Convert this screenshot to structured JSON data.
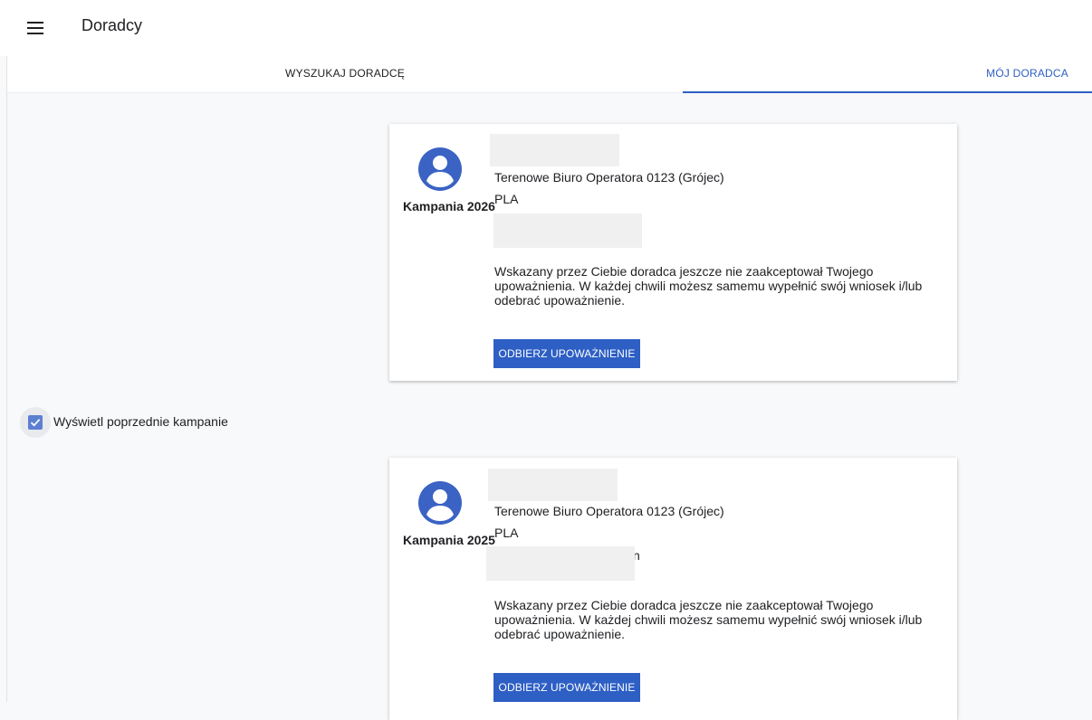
{
  "header": {
    "menu_icon": "menu-icon",
    "title": "Doradcy"
  },
  "tabs": [
    {
      "label": "WYSZUKAJ DORADCĘ",
      "active": false
    },
    {
      "label": "MÓJ DORADCA",
      "active": true
    }
  ],
  "colors": {
    "accent": "#2d5fc4",
    "checkbox": "#5b7fd1"
  },
  "cards": [
    {
      "icon": "account-circle-icon",
      "campaign": "Kampania 2026",
      "office": "Terenowe Biuro Operatora 0123 (Grójec)",
      "country": "PLA",
      "message": "Wskazany przez Ciebie doradca jeszcze nie zaakceptował Twojego upoważnienia. W każdej chwili możesz samemu wypełnić swój wniosek i/lub odebrać upoważnienie.",
      "button": "ODBIERZ UPOWAŻNIENIE"
    },
    {
      "icon": "account-circle-icon",
      "campaign": "Kampania 2025",
      "office": "Terenowe Biuro Operatora 0123 (Grójec)",
      "country": "PLA",
      "trailing": "n",
      "message": "Wskazany przez Ciebie doradca jeszcze nie zaakceptował Twojego upoważnienia. W każdej chwili możesz samemu wypełnić swój wniosek i/lub odebrać upoważnienie.",
      "button": "ODBIERZ UPOWAŻNIENIE"
    }
  ],
  "previous_campaigns": {
    "label": "Wyświetl poprzednie kampanie",
    "checked": true
  }
}
